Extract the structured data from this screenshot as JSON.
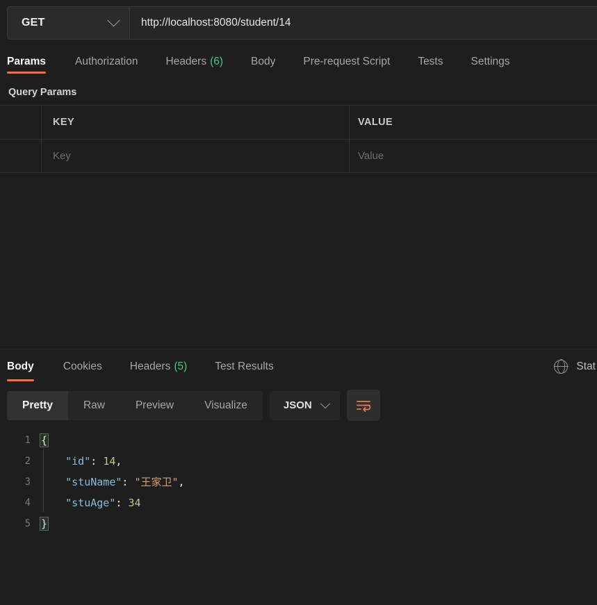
{
  "request": {
    "method": "GET",
    "method_icon": "chevron-down-icon",
    "url": "http://localhost:8080/student/14",
    "tabs": [
      {
        "label": "Params",
        "count": "",
        "active": true
      },
      {
        "label": "Authorization",
        "count": "",
        "active": false
      },
      {
        "label": "Headers",
        "count": "(6)",
        "active": false
      },
      {
        "label": "Body",
        "count": "",
        "active": false
      },
      {
        "label": "Pre-request Script",
        "count": "",
        "active": false
      },
      {
        "label": "Tests",
        "count": "",
        "active": false
      },
      {
        "label": "Settings",
        "count": "",
        "active": false
      }
    ],
    "query_params": {
      "section_title": "Query Params",
      "columns": {
        "key": "KEY",
        "value": "VALUE"
      },
      "empty_row": {
        "key_placeholder": "Key",
        "value_placeholder": "Value"
      }
    }
  },
  "response": {
    "tabs": [
      {
        "label": "Body",
        "count": "",
        "active": true
      },
      {
        "label": "Cookies",
        "count": "",
        "active": false
      },
      {
        "label": "Headers",
        "count": "(5)",
        "active": false
      },
      {
        "label": "Test Results",
        "count": "",
        "active": false
      }
    ],
    "status_area": {
      "globe_icon": "globe-icon",
      "status_label": "Stat"
    },
    "body_toolbar": {
      "views": [
        {
          "label": "Pretty",
          "active": true
        },
        {
          "label": "Raw",
          "active": false
        },
        {
          "label": "Preview",
          "active": false
        },
        {
          "label": "Visualize",
          "active": false
        }
      ],
      "format": "JSON",
      "format_icon": "chevron-down-icon",
      "wrap_icon": "word-wrap-icon"
    },
    "body_code": {
      "line_numbers": [
        "1",
        "2",
        "3",
        "4",
        "5"
      ],
      "lines": [
        {
          "open_brace": "{"
        },
        {
          "indent": "    ",
          "key": "\"id\"",
          "colon": ": ",
          "value": "14",
          "value_type": "number",
          "comma": ","
        },
        {
          "indent": "    ",
          "key": "\"stuName\"",
          "colon": ": ",
          "value": "\"王家卫\"",
          "value_type": "string",
          "comma": ","
        },
        {
          "indent": "    ",
          "key": "\"stuAge\"",
          "colon": ": ",
          "value": "34",
          "value_type": "number",
          "comma": ""
        },
        {
          "close_brace": "}"
        }
      ]
    }
  },
  "colors": {
    "accent_orange": "#ff6c37",
    "count_green": "#42c98a",
    "json_key": "#86bddc",
    "json_number": "#b5cc8e",
    "json_string": "#d99b7c",
    "background": "#1e1e1e"
  }
}
